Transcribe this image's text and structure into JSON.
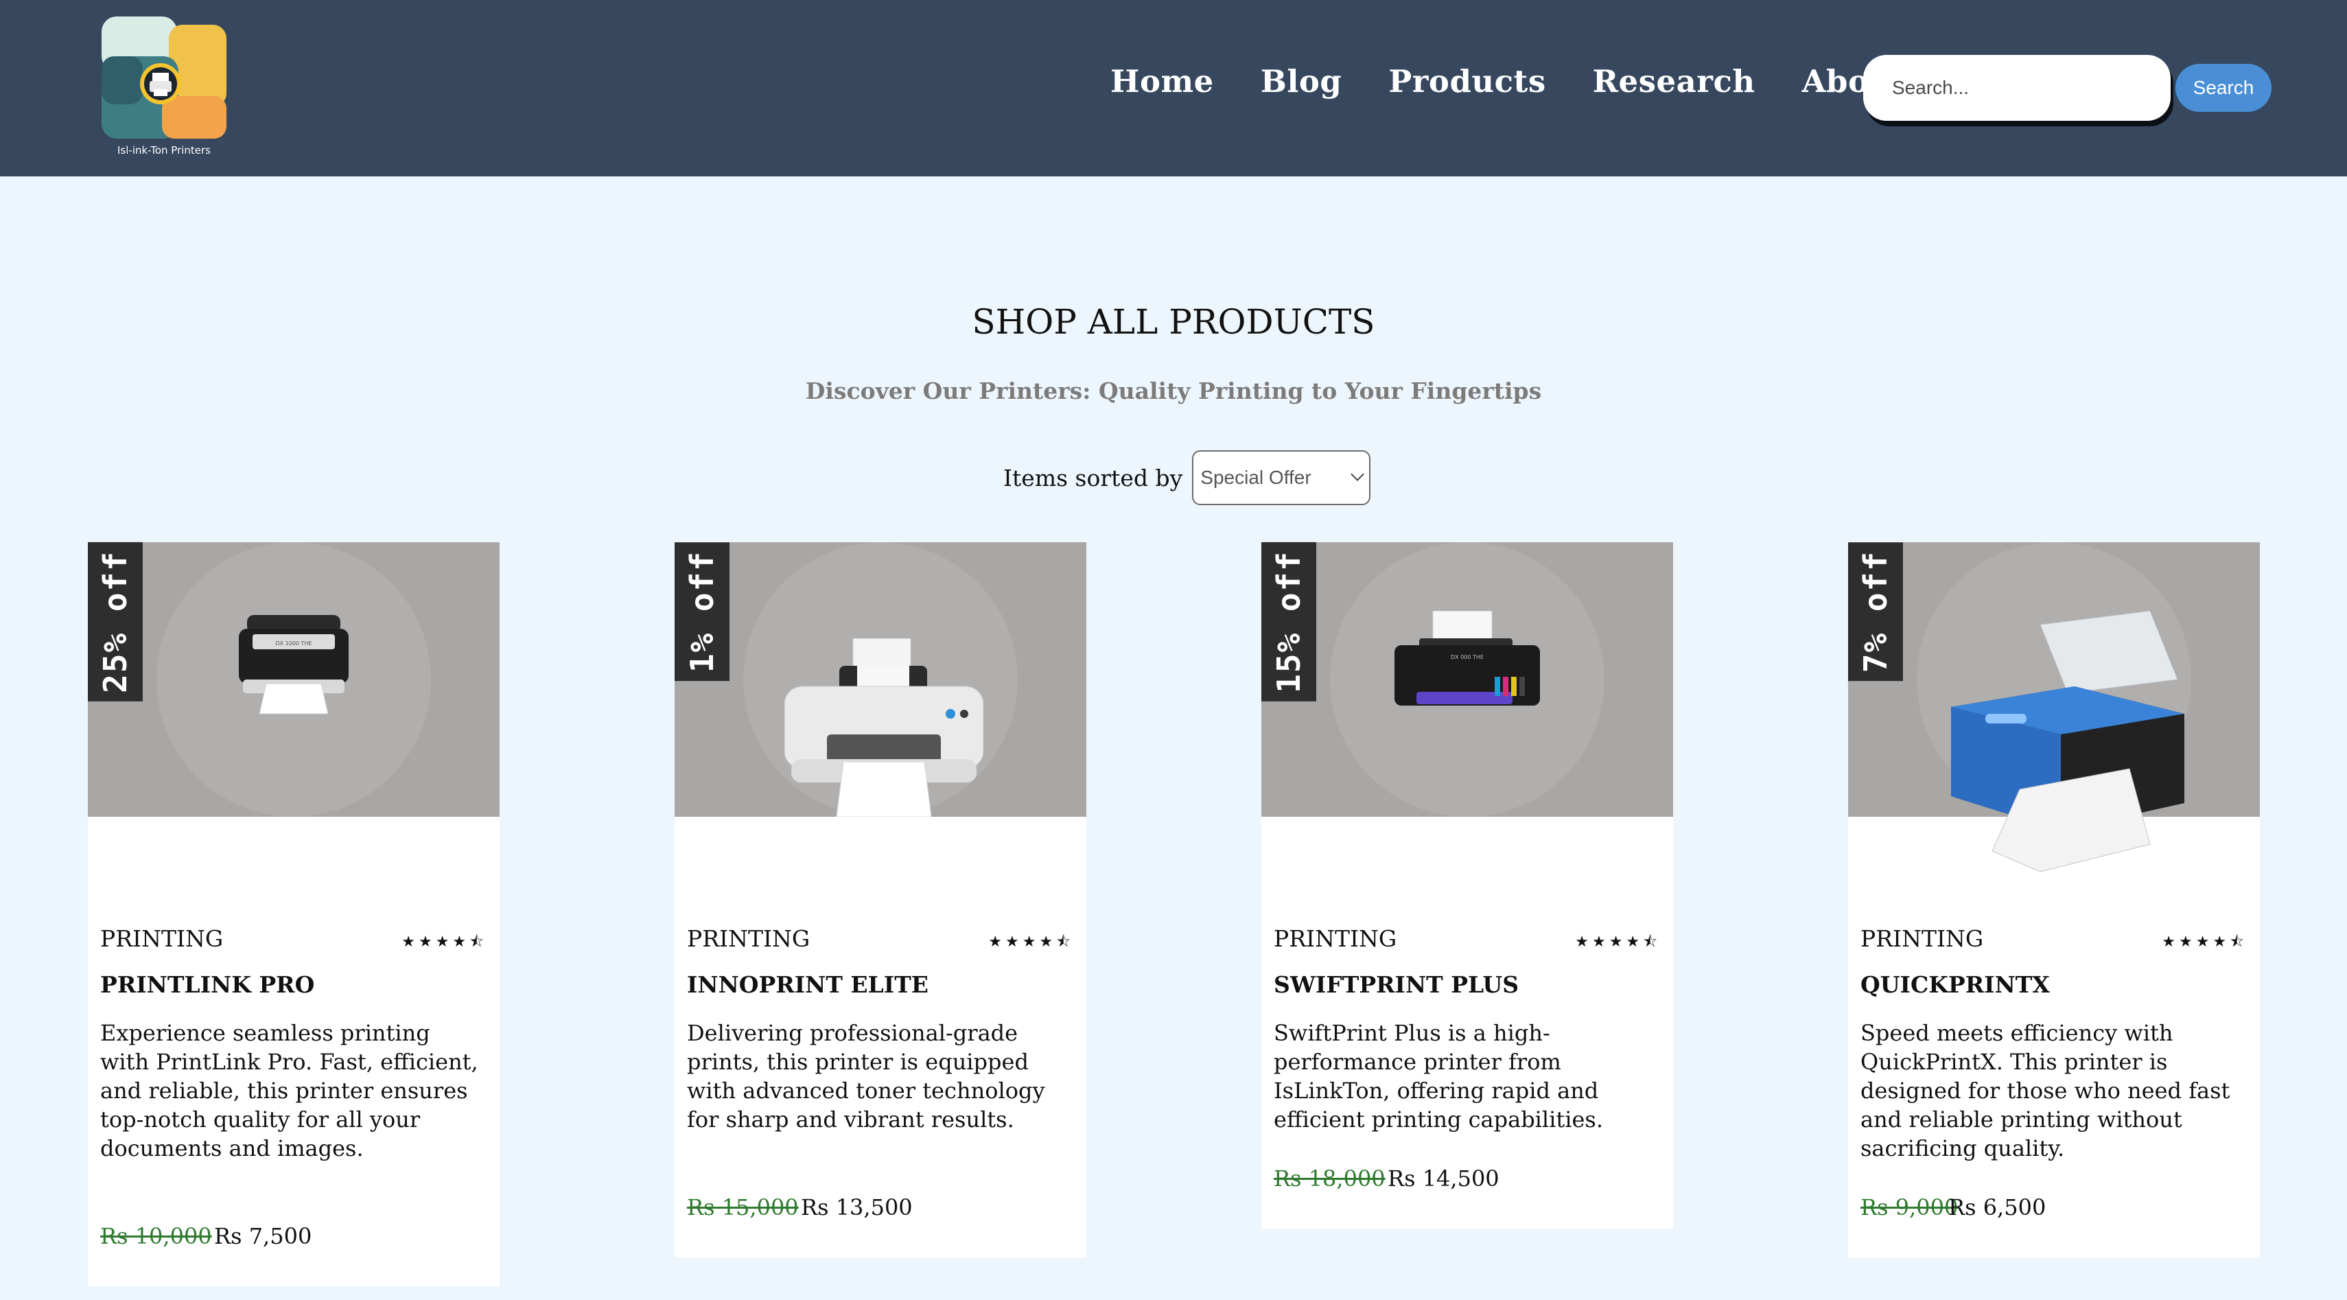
{
  "brand": {
    "logo_text": "Isl-ink-Ton Printers"
  },
  "nav": {
    "items": [
      "Home",
      "Blog",
      "Products",
      "Research",
      "About Us"
    ]
  },
  "search": {
    "placeholder": "Search...",
    "button_label": "Search"
  },
  "section": {
    "title": "SHOP ALL PRODUCTS",
    "subtitle": "Discover Our Printers: Quality Printing to Your Fingertips",
    "sort_label": "Items sorted by",
    "sort_value": "Special Offer"
  },
  "products": [
    {
      "discount": "25% off",
      "category": "PRINTING",
      "rating": "★★★★⯪",
      "name": "PRINTLINK PRO",
      "description": "Experience seamless printing with PrintLink Pro. Fast, efficient, and reliable, this printer ensures top-notch quality for all your documents and images.",
      "old_price": "Rs 10,000",
      "price": "Rs 7,500"
    },
    {
      "discount": "1% off",
      "category": "PRINTING",
      "rating": "★★★★⯪",
      "name": "INNOPRINT ELITE",
      "description": "Delivering professional-grade prints, this printer is equipped with advanced toner technology for sharp and vibrant results.",
      "old_price": "Rs 15,000",
      "price": "Rs 13,500"
    },
    {
      "discount": "15% off",
      "category": "PRINTING",
      "rating": "★★★★⯪",
      "name": "SWIFTPRINT PLUS",
      "description": "SwiftPrint Plus is a high-performance printer from IsLinkTon, offering rapid and efficient printing capabilities.",
      "old_price": "Rs 18,000",
      "price": "Rs 14,500"
    },
    {
      "discount": "7% off",
      "category": "PRINTING",
      "rating": "★★★★⯪",
      "name": "QUICKPRINTX",
      "description": "Speed meets efficiency with QuickPrintX. This printer is designed for those who need fast and reliable printing without sacrificing quality.",
      "old_price": "Rs 9,000",
      "price": "Rs 6,500"
    }
  ]
}
